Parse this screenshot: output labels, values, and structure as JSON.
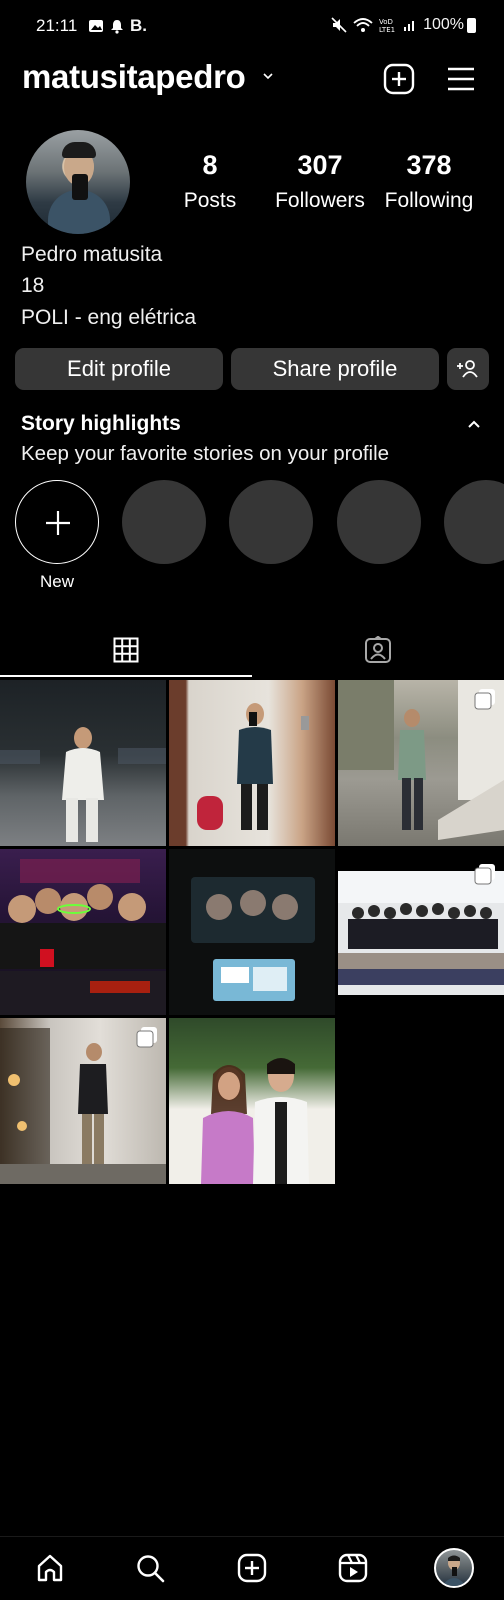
{
  "status_bar": {
    "time": "21:11",
    "carrier_badge": "B.",
    "battery": "100%"
  },
  "header": {
    "username": "matusitapedro"
  },
  "profile": {
    "stats": {
      "posts_count": "8",
      "posts_label": "Posts",
      "followers_count": "307",
      "followers_label": "Followers",
      "following_count": "378",
      "following_label": "Following"
    },
    "bio": {
      "name": "Pedro matusita",
      "age": "18",
      "description": "POLI - eng elétrica"
    },
    "buttons": {
      "edit": "Edit profile",
      "share": "Share profile"
    }
  },
  "highlights": {
    "title": "Story highlights",
    "subtitle": "Keep your favorite stories on your profile",
    "new_label": "New"
  },
  "tabs": [
    {
      "icon": "grid-icon",
      "active": true
    },
    {
      "icon": "tagged-icon",
      "active": false
    }
  ],
  "posts": [
    {
      "multi": false
    },
    {
      "multi": false
    },
    {
      "multi": true
    },
    {
      "multi": false
    },
    {
      "multi": false
    },
    {
      "multi": true
    },
    {
      "multi": true
    },
    {
      "multi": false
    }
  ],
  "bottom_nav": [
    "home-icon",
    "search-icon",
    "create-icon",
    "reels-icon",
    "profile-avatar"
  ],
  "colors": {
    "background": "#000000",
    "button_bg": "#363636",
    "text": "#ffffff"
  }
}
